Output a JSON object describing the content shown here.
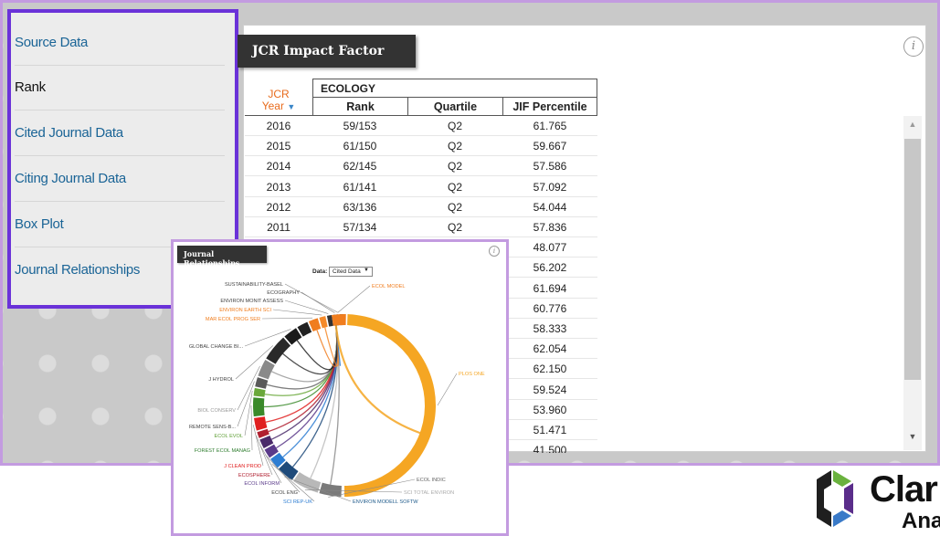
{
  "sidebar": {
    "items": [
      {
        "label": "Source Data",
        "active": false
      },
      {
        "label": "Rank",
        "active": true
      },
      {
        "label": "Cited Journal Data",
        "active": false
      },
      {
        "label": "Citing Journal Data",
        "active": false
      },
      {
        "label": "Box Plot",
        "active": false
      },
      {
        "label": "Journal Relationships",
        "active": false
      }
    ]
  },
  "main": {
    "title": "JCR Impact Factor",
    "info_icon": "i",
    "table": {
      "year_header_line1": "JCR",
      "year_header_line2": "Year",
      "sort_indicator": "▼",
      "group_header": "ECOLOGY",
      "columns": [
        "Rank",
        "Quartile",
        "JIF Percentile"
      ],
      "rows": [
        {
          "year": "2016",
          "rank": "59/153",
          "quartile": "Q2",
          "percentile": "61.765"
        },
        {
          "year": "2015",
          "rank": "61/150",
          "quartile": "Q2",
          "percentile": "59.667"
        },
        {
          "year": "2014",
          "rank": "62/145",
          "quartile": "Q2",
          "percentile": "57.586"
        },
        {
          "year": "2013",
          "rank": "61/141",
          "quartile": "Q2",
          "percentile": "57.092"
        },
        {
          "year": "2012",
          "rank": "63/136",
          "quartile": "Q2",
          "percentile": "54.044"
        },
        {
          "year": "2011",
          "rank": "57/134",
          "quartile": "Q2",
          "percentile": "57.836"
        },
        {
          "year": "",
          "rank": "",
          "quartile": "",
          "percentile": "48.077"
        },
        {
          "year": "",
          "rank": "",
          "quartile": "",
          "percentile": "56.202"
        },
        {
          "year": "",
          "rank": "",
          "quartile": "",
          "percentile": "61.694"
        },
        {
          "year": "",
          "rank": "",
          "quartile": "",
          "percentile": "60.776"
        },
        {
          "year": "",
          "rank": "",
          "quartile": "",
          "percentile": "58.333"
        },
        {
          "year": "",
          "rank": "",
          "quartile": "",
          "percentile": "62.054"
        },
        {
          "year": "",
          "rank": "",
          "quartile": "",
          "percentile": "62.150"
        },
        {
          "year": "",
          "rank": "",
          "quartile": "",
          "percentile": "59.524"
        },
        {
          "year": "",
          "rank": "",
          "quartile": "",
          "percentile": "53.960"
        },
        {
          "year": "",
          "rank": "",
          "quartile": "",
          "percentile": "51.471"
        },
        {
          "year": "",
          "rank": "",
          "quartile": "",
          "percentile": "41.500"
        }
      ]
    },
    "scroll_up": "▲",
    "scroll_down": "▼"
  },
  "journal_relationships": {
    "title": "Journal Relationships",
    "info_icon": "i",
    "data_label": "Data:",
    "data_select_value": "Cited Data",
    "focus_journal": "PLOS ONE",
    "labels": [
      {
        "text": "SUSTAINABILITY-BASEL",
        "color": "#444444"
      },
      {
        "text": "ECOGRAPHY",
        "color": "#444444"
      },
      {
        "text": "ENVIRON MONIT ASSESS",
        "color": "#444444"
      },
      {
        "text": "ENVIRON EARTH SCI",
        "color": "#f07d1e"
      },
      {
        "text": "MAR ECOL PROG SER",
        "color": "#f07d1e"
      },
      {
        "text": "GLOBAL CHANGE BI...",
        "color": "#444444"
      },
      {
        "text": "J HYDROL",
        "color": "#444444"
      },
      {
        "text": "BIOL CONSERV",
        "color": "#999999"
      },
      {
        "text": "REMOTE SENS-B...",
        "color": "#444444"
      },
      {
        "text": "ECOL EVOL",
        "color": "#5e9e35"
      },
      {
        "text": "FOREST ECOL MANAG",
        "color": "#2f7d2f"
      },
      {
        "text": "J CLEAN PROD",
        "color": "#e02020"
      },
      {
        "text": "ECOSPHERE",
        "color": "#b02030"
      },
      {
        "text": "ECOL INFORM",
        "color": "#5a3a8a"
      },
      {
        "text": "ECOL ENG",
        "color": "#444444"
      },
      {
        "text": "SCI REP-UK",
        "color": "#2d7dd2"
      },
      {
        "text": "ENVIRON MODELL SOFTW",
        "color": "#1e5a8a"
      },
      {
        "text": "SCI TOTAL ENVIRON",
        "color": "#aaaaaa"
      },
      {
        "text": "ECOL INDIC",
        "color": "#666666"
      },
      {
        "text": "PLOS ONE",
        "color": "#f5a623"
      },
      {
        "text": "ECOL MODEL",
        "color": "#f07d1e"
      }
    ],
    "colors": {
      "plos": "#f5a623",
      "ecol_model": "#f07d1e",
      "black": "#222222",
      "gray": "#8a8a8a",
      "green": "#3a8a2a",
      "red": "#e02020",
      "purple": "#5a3a8a",
      "blue": "#2d7dd2",
      "navy": "#1e4a7a"
    }
  },
  "logo": {
    "name": "Clar",
    "sub": "Analy"
  }
}
